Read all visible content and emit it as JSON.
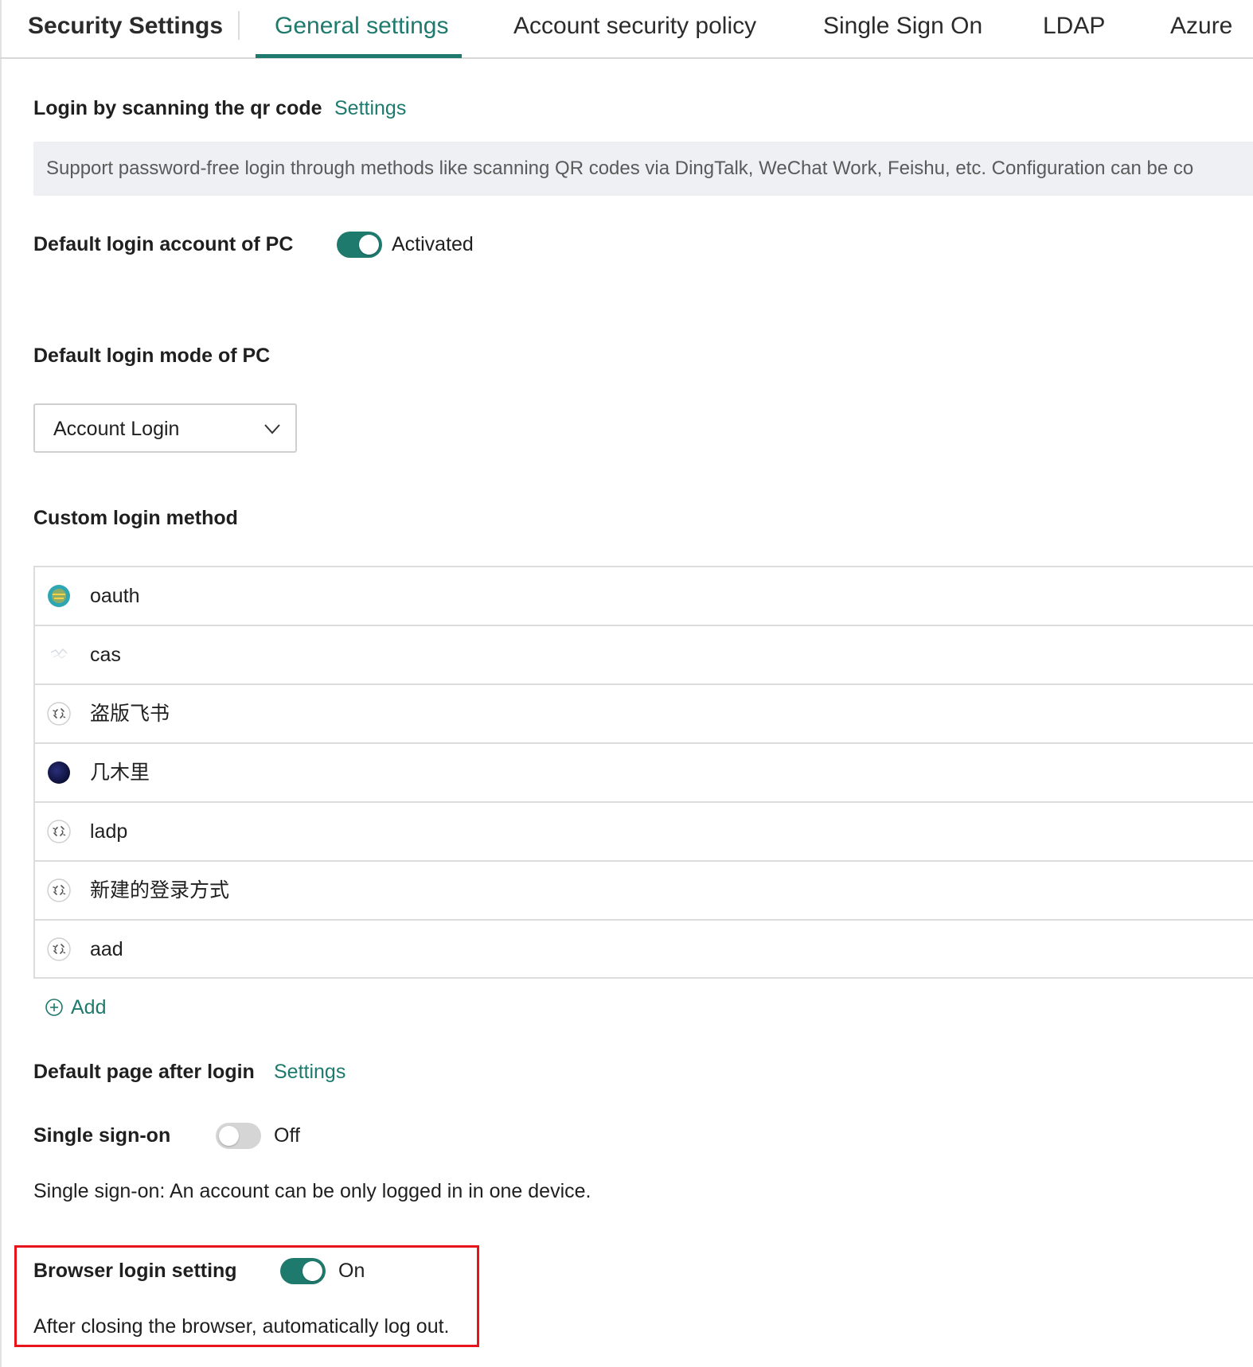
{
  "header": {
    "title": "Security Settings",
    "tabs": [
      {
        "label": "General settings",
        "active": true
      },
      {
        "label": "Account security policy",
        "active": false
      },
      {
        "label": "Single Sign On",
        "active": false
      },
      {
        "label": "LDAP",
        "active": false
      },
      {
        "label": "Azure",
        "active": false
      }
    ]
  },
  "qr_login": {
    "label": "Login by scanning the qr code",
    "link": "Settings",
    "info": "Support password-free login through methods like scanning QR codes via DingTalk, WeChat Work, Feishu, etc. Configuration can be co"
  },
  "pc_default_account": {
    "label": "Default login account of PC",
    "toggle_on": true,
    "status": "Activated"
  },
  "pc_default_mode": {
    "label": "Default login mode of PC",
    "selected": "Account Login",
    "icon": "chevron-down-icon"
  },
  "custom_login": {
    "label": "Custom login method",
    "methods": [
      {
        "name": "oauth",
        "icon": "oauth-logo-icon"
      },
      {
        "name": "cas",
        "icon": "cas-logo-icon"
      },
      {
        "name": "盗版飞书",
        "icon": "broken-link-icon"
      },
      {
        "name": "几木里",
        "icon": "dark-circle-logo-icon"
      },
      {
        "name": "ladp",
        "icon": "broken-link-icon"
      },
      {
        "name": "新建的登录方式",
        "icon": "broken-link-icon"
      },
      {
        "name": "aad",
        "icon": "broken-link-icon"
      }
    ],
    "add_label": "Add"
  },
  "default_page": {
    "label": "Default page after login",
    "link": "Settings"
  },
  "single_sign_on": {
    "label": "Single sign-on",
    "toggle_on": false,
    "status": "Off",
    "description": "Single sign-on: An account can be only logged in in one device."
  },
  "browser_login": {
    "label": "Browser login setting",
    "toggle_on": true,
    "status": "On",
    "description": "After closing the browser, automatically log out."
  },
  "colors": {
    "accent": "#1f7a6e",
    "highlight": "#e8141c",
    "info_bg": "#eef0f4"
  }
}
